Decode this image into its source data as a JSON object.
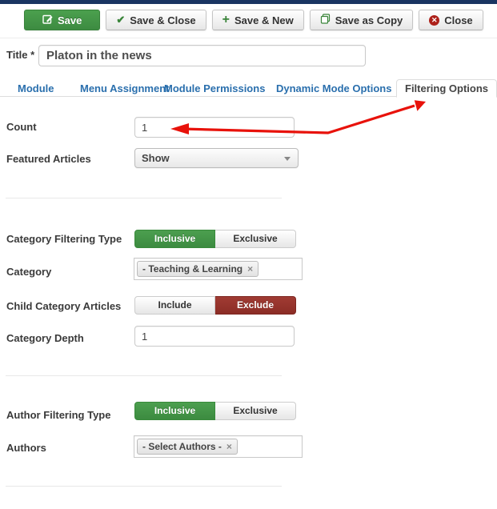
{
  "toolbar": {
    "save": "Save",
    "save_close": "Save & Close",
    "save_new": "Save & New",
    "save_copy": "Save as Copy",
    "close": "Close",
    "close_glyph": "✕",
    "check_glyph": "✔",
    "plus_glyph": "+"
  },
  "title_field": {
    "label": "Title *",
    "value": "Platon in the news"
  },
  "tabs": [
    {
      "label": "Module",
      "active": false
    },
    {
      "label": "Menu Assignment",
      "active": false
    },
    {
      "label": "Module Permissions",
      "active": false
    },
    {
      "label": "Dynamic Mode Options",
      "active": false
    },
    {
      "label": "Filtering Options",
      "active": true
    }
  ],
  "fields": {
    "count": {
      "label": "Count",
      "value": "1"
    },
    "featured_articles": {
      "label": "Featured Articles",
      "value": "Show"
    },
    "category_filtering_type": {
      "label": "Category Filtering Type",
      "options": [
        "Inclusive",
        "Exclusive"
      ],
      "selected": "Inclusive"
    },
    "category": {
      "label": "Category",
      "selected_tag": "- Teaching & Learning",
      "remove": "×"
    },
    "child_category_articles": {
      "label": "Child Category Articles",
      "options": [
        "Include",
        "Exclude"
      ],
      "selected": "Exclude"
    },
    "category_depth": {
      "label": "Category Depth",
      "value": "1"
    },
    "author_filtering_type": {
      "label": "Author Filtering Type",
      "options": [
        "Inclusive",
        "Exclusive"
      ],
      "selected": "Inclusive"
    },
    "authors": {
      "label": "Authors",
      "selected_tag": "- Select Authors -",
      "remove": "×"
    }
  },
  "annotation_arrow": {
    "from": "Filtering Options tab",
    "to": "Count field",
    "color": "#e8120b"
  },
  "colors": {
    "accent_green": "#3d8b41",
    "accent_red": "#8c2d26",
    "link_blue": "#2a6fad",
    "topbar_navy": "#1a3562",
    "arrow_red": "#e8120b"
  }
}
